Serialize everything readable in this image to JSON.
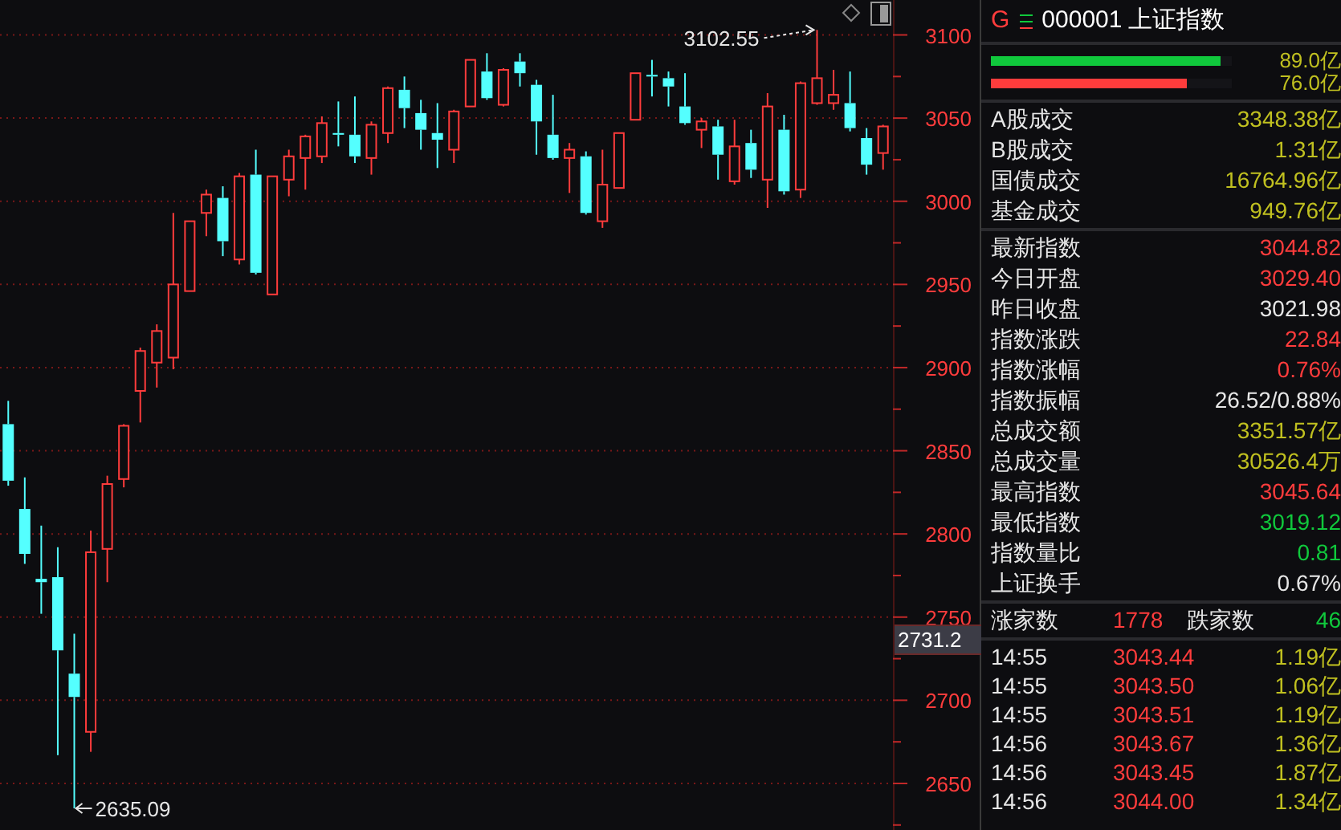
{
  "chart": {
    "cursor_label": "2731.2",
    "chart_data": {
      "type": "candlestick",
      "ylim": [
        2622,
        3121
      ],
      "yticks": [
        2650,
        2700,
        2750,
        2800,
        2850,
        2900,
        2950,
        3000,
        3050,
        3100
      ],
      "grid": true,
      "ohlc": [
        [
          2866,
          2880,
          2829,
          2832
        ],
        [
          2815,
          2834,
          2782,
          2788
        ],
        [
          2773,
          2805,
          2752,
          2771
        ],
        [
          2774,
          2792,
          2667,
          2730
        ],
        [
          2716,
          2740,
          2635,
          2702
        ],
        [
          2681,
          2802,
          2669,
          2789
        ],
        [
          2791,
          2835,
          2771,
          2830
        ],
        [
          2833,
          2866,
          2828,
          2865
        ],
        [
          2886,
          2912,
          2867,
          2910
        ],
        [
          2903,
          2926,
          2888,
          2922
        ],
        [
          2906,
          2993,
          2899,
          2950
        ],
        [
          2946,
          2988,
          2946,
          2988
        ],
        [
          2993,
          3007,
          2979,
          3004
        ],
        [
          3002,
          3009,
          2967,
          2976
        ],
        [
          2965,
          3017,
          2962,
          3015
        ],
        [
          3016,
          3031,
          2956,
          2957
        ],
        [
          2944,
          3015,
          2944,
          3015
        ],
        [
          3013,
          3031,
          3003,
          3027
        ],
        [
          3026,
          3040,
          3007,
          3039
        ],
        [
          3027,
          3051,
          3023,
          3047
        ],
        [
          3041,
          3060,
          3033,
          3040
        ],
        [
          3040,
          3063,
          3023,
          3027
        ],
        [
          3026,
          3048,
          3016,
          3046
        ],
        [
          3041,
          3069,
          3035,
          3068
        ],
        [
          3067,
          3075,
          3044,
          3056
        ],
        [
          3053,
          3061,
          3031,
          3043
        ],
        [
          3041,
          3059,
          3020,
          3037
        ],
        [
          3031,
          3055,
          3023,
          3054
        ],
        [
          3057,
          3085,
          3057,
          3085
        ],
        [
          3078,
          3089,
          3061,
          3062
        ],
        [
          3058,
          3080,
          3057,
          3079
        ],
        [
          3084,
          3089,
          3069,
          3077
        ],
        [
          3070,
          3073,
          3028,
          3048
        ],
        [
          3040,
          3064,
          3025,
          3026
        ],
        [
          3026,
          3035,
          3005,
          3031
        ],
        [
          3027,
          3030,
          2992,
          2993
        ],
        [
          2988,
          3031,
          2984,
          3010
        ],
        [
          3008,
          3041,
          3008,
          3041
        ],
        [
          3049,
          3077,
          3049,
          3077
        ],
        [
          3076,
          3085,
          3063,
          3075
        ],
        [
          3074,
          3078,
          3057,
          3069
        ],
        [
          3057,
          3077,
          3046,
          3047
        ],
        [
          3043,
          3050,
          3032,
          3048
        ],
        [
          3045,
          3049,
          3013,
          3028
        ],
        [
          3012,
          3049,
          3010,
          3033
        ],
        [
          3035,
          3043,
          3014,
          3019
        ],
        [
          3013,
          3065,
          2996,
          3057
        ],
        [
          3043,
          3052,
          3004,
          3006
        ],
        [
          3007,
          3072,
          3002,
          3071
        ],
        [
          3059,
          3103,
          3058,
          3074
        ],
        [
          3059,
          3079,
          3055,
          3064
        ],
        [
          3059,
          3078,
          3042,
          3044
        ],
        [
          3038,
          3044,
          3016,
          3022
        ],
        [
          3029,
          3046,
          3019,
          3045
        ]
      ],
      "annotations": [
        "3102.55",
        "2635.09"
      ]
    }
  },
  "quote_panel": {
    "prefix": "G",
    "code": "000001",
    "name": "上证指数",
    "flow_bars": [
      {
        "color": "#10c83c",
        "level": 0.95,
        "value": "89.0亿"
      },
      {
        "color": "#ff3c3c",
        "level": 0.81,
        "value": "76.0亿"
      }
    ],
    "turnover": [
      {
        "label": "A股成交",
        "value": "3348.38亿"
      },
      {
        "label": "B股成交",
        "value": "1.31亿"
      },
      {
        "label": "国债成交",
        "value": "16764.96亿"
      },
      {
        "label": "基金成交",
        "value": "949.76亿"
      }
    ],
    "stats": [
      {
        "label": "最新指数",
        "value": "3044.82",
        "color": "#ff3c3c"
      },
      {
        "label": "今日开盘",
        "value": "3029.40",
        "color": "#ff3c3c"
      },
      {
        "label": "昨日收盘",
        "value": "3021.98",
        "color": "#e6e6e6"
      },
      {
        "label": "指数涨跌",
        "value": "22.84",
        "color": "#ff3c3c"
      },
      {
        "label": "指数涨幅",
        "value": "0.76%",
        "color": "#ff3c3c"
      },
      {
        "label": "指数振幅",
        "value": "26.52/0.88%",
        "color": "#e6e6e6"
      },
      {
        "label": "总成交额",
        "value": "3351.57亿",
        "color": "#c0c020"
      },
      {
        "label": "总成交量",
        "value": "30526.4万",
        "color": "#c0c020"
      },
      {
        "label": "最高指数",
        "value": "3045.64",
        "color": "#ff3c3c"
      },
      {
        "label": "最低指数",
        "value": "3019.12",
        "color": "#10c83c"
      },
      {
        "label": "指数量比",
        "value": "0.81",
        "color": "#10c83c"
      },
      {
        "label": "上证换手",
        "value": "0.67%",
        "color": "#e6e6e6"
      }
    ],
    "breadth": {
      "up_label": "涨家数",
      "up_count": "1778",
      "down_label": "跌家数",
      "down_count": "46"
    },
    "ticks": [
      {
        "time": "14:55",
        "price": "3043.44",
        "volume": "1.19亿"
      },
      {
        "time": "14:55",
        "price": "3043.50",
        "volume": "1.06亿"
      },
      {
        "time": "14:55",
        "price": "3043.51",
        "volume": "1.19亿"
      },
      {
        "time": "14:56",
        "price": "3043.67",
        "volume": "1.36亿"
      },
      {
        "time": "14:56",
        "price": "3043.45",
        "volume": "1.87亿"
      },
      {
        "time": "14:56",
        "price": "3044.00",
        "volume": "1.34亿"
      }
    ]
  }
}
